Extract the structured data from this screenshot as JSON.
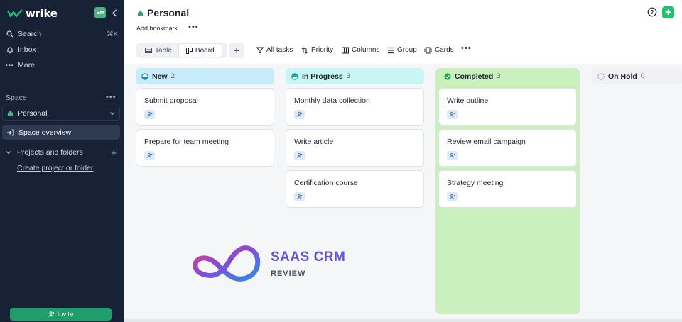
{
  "app": {
    "logo_text": "wrike"
  },
  "sidebar": {
    "avatar_initials": "EM",
    "nav": [
      {
        "label": "Search",
        "shortcut": "⌘K"
      },
      {
        "label": "Inbox"
      },
      {
        "label": "More"
      }
    ],
    "space_label": "Space",
    "space_select": "Personal",
    "overview_label": "Space overview",
    "projects_label": "Projects and folders",
    "create_link": "Create project or folder",
    "invite_label": "Invite"
  },
  "header": {
    "title": "Personal",
    "bookmark_label": "Add bookmark"
  },
  "views": {
    "table": "Table",
    "board": "Board"
  },
  "toolbar": {
    "all_tasks": "All tasks",
    "priority": "Priority",
    "columns": "Columns",
    "group": "Group",
    "cards": "Cards"
  },
  "columns": [
    {
      "name": "New",
      "count": "2",
      "color": "#c9ecfb",
      "cards": [
        "Submit proposal",
        "Prepare for team meeting"
      ]
    },
    {
      "name": "In Progress",
      "count": "3",
      "color": "#c8f6f5",
      "cards": [
        "Monthly data collection",
        "Write article",
        "Certification course"
      ]
    },
    {
      "name": "Completed",
      "count": "3",
      "color": "#c9f0bd",
      "cards": [
        "Write outline",
        "Review email campaign",
        "Strategy meeting"
      ]
    },
    {
      "name": "On Hold",
      "count": "0",
      "color": "#f0f1f4",
      "cards": []
    }
  ],
  "watermark": {
    "title": "SAAS CRM",
    "subtitle": "REVIEW"
  },
  "colors": {
    "sidebar": "#182236",
    "accent_green": "#1fc36c",
    "invite": "#1e9e6a"
  }
}
